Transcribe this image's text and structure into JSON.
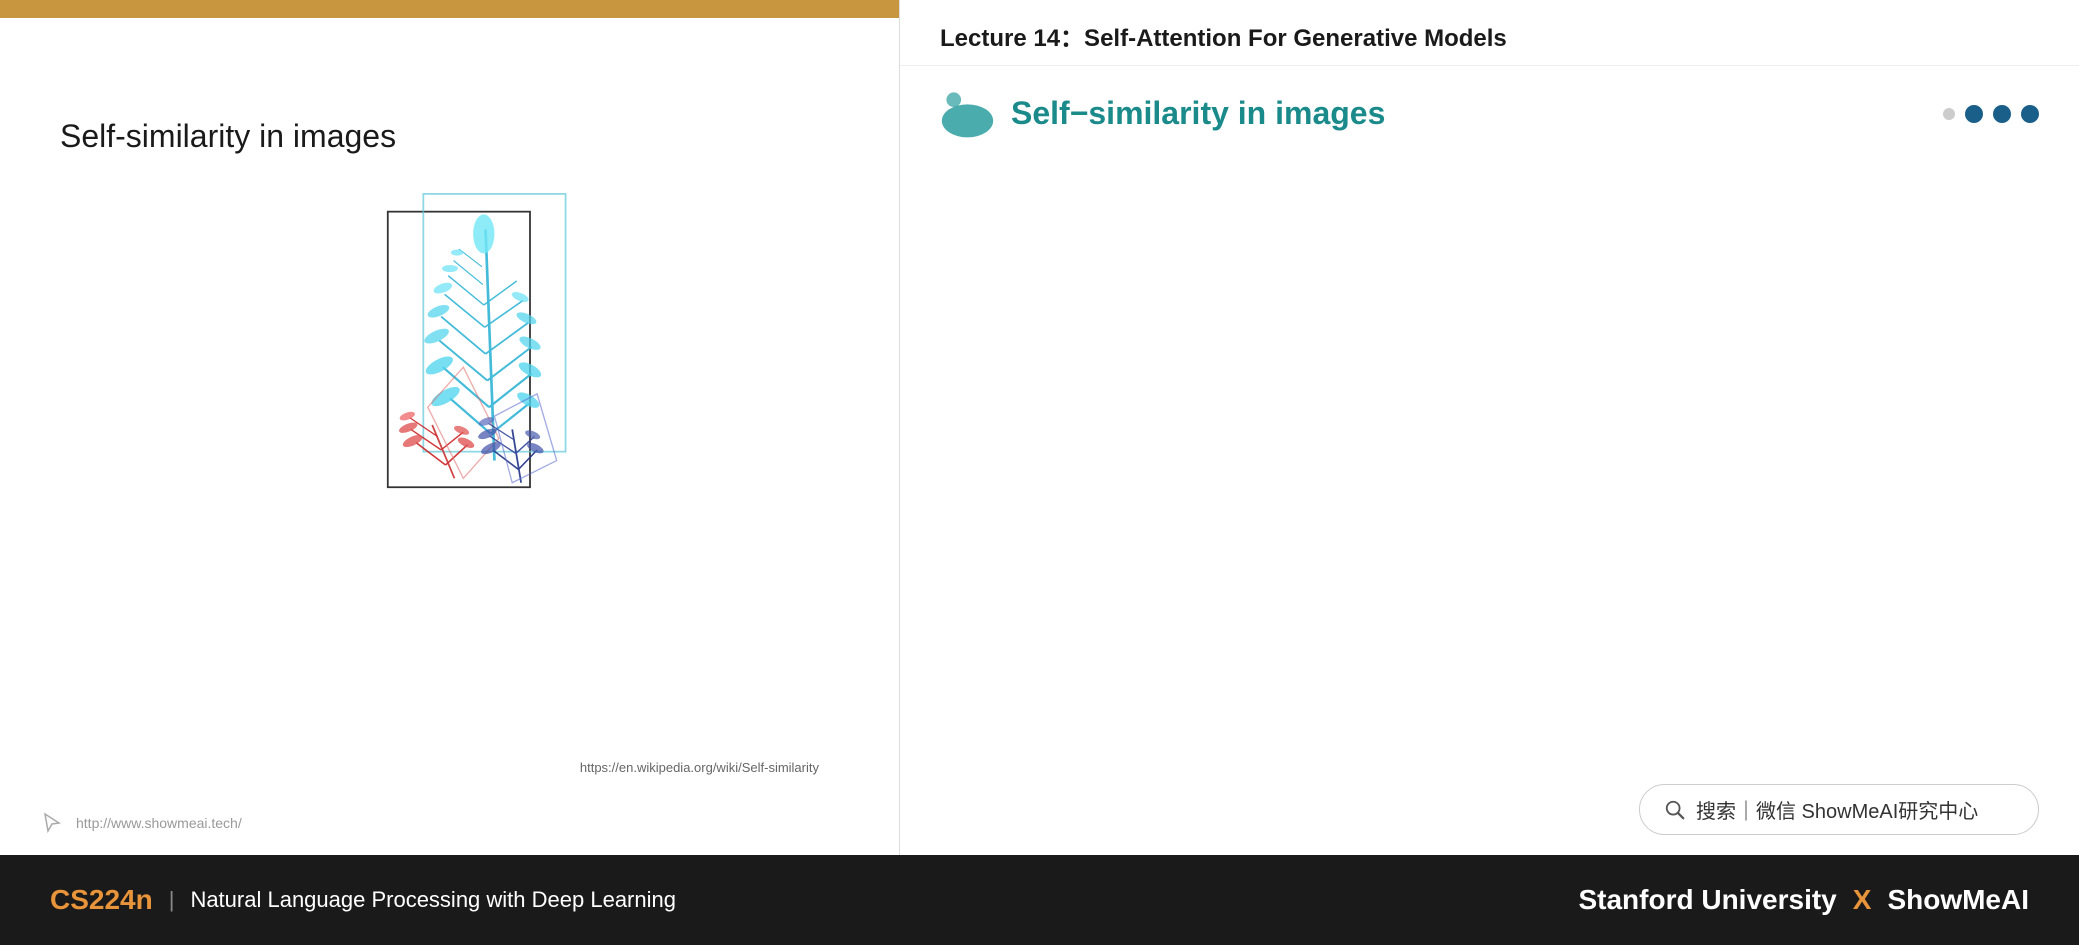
{
  "slide": {
    "top_bar_color": "#c8963e",
    "title": "Self-similarity in images",
    "image_url": "https://en.wikipedia.org/wiki/Self-similarity",
    "footer_url": "http://www.showmeai.tech/"
  },
  "right_panel": {
    "lecture_title": "Lecture 14：Self-Attention For Generative Models",
    "slide_subtitle": "Self−similarity in images",
    "dots": [
      "empty",
      "filled",
      "filled",
      "filled"
    ]
  },
  "search": {
    "placeholder": "搜索｜微信 ShowMeAI研究中心"
  },
  "bottom_bar": {
    "course_code": "CS224n",
    "divider": "|",
    "course_name": "Natural Language Processing with Deep Learning",
    "university": "Stanford University",
    "x": "X",
    "brand": "ShowMeAI"
  }
}
